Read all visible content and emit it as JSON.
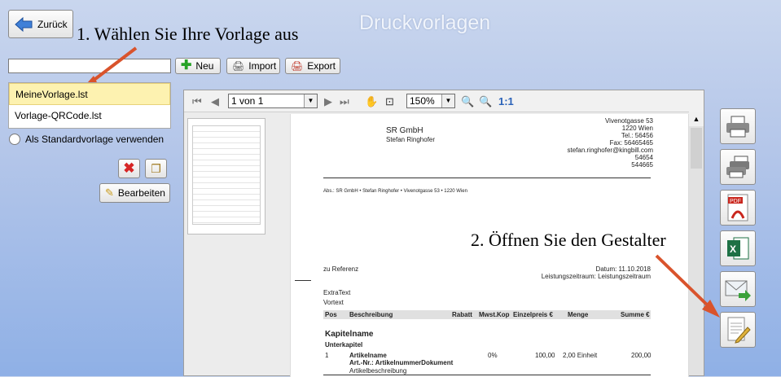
{
  "header": {
    "back_label": "Zurück",
    "title": "Druckvorlagen",
    "step1": "1. Wählen Sie Ihre Vorlage aus",
    "step2": "2. Öffnen Sie den Gestalter"
  },
  "toolbar": {
    "search_value": "",
    "new_label": "Neu",
    "import_label": "Import",
    "export_label": "Export"
  },
  "templates": [
    {
      "label": "MeineVorlage.lst",
      "selected": true
    },
    {
      "label": "Vorlage-QRCode.lst",
      "selected": false
    }
  ],
  "default_option": "Als Standardvorlage verwenden",
  "edit_label": "Bearbeiten",
  "viewer": {
    "page_combo": "1 von 1",
    "zoom_combo": "150%",
    "zoom_reset": "1:1"
  },
  "document": {
    "company": "SR GmbH",
    "contact": "Stefan Ringhofer",
    "address_lines": [
      "Vivenotgasse 53",
      "1220 Wien",
      "Tel.: 56456",
      "Fax: 56465465",
      "stefan.ringhofer@kingbill.com",
      "54654",
      "544665"
    ],
    "sender_line": "Abs.: SR GmbH • Stefan Ringhofer • Vivenotgasse 53 • 1220 Wien",
    "reference": "zu Referenz",
    "date": "Datum: 11.10.2018",
    "period": "Leistungszeitraum: Leistungszeitraum",
    "extra_text": "ExtraText",
    "vortext": "Vortext",
    "columns": [
      "Pos",
      "Beschreibung",
      "Rabatt",
      "Mwst.",
      "Kop",
      "Einzelpreis €",
      "Menge",
      "Summe €"
    ],
    "chapter": "Kapitelname",
    "subchapter": "Unterkapitel",
    "row": {
      "pos": "1",
      "name": "Artikelname",
      "artnr": "Art.-Nr.: ArtikelnummerDokument",
      "desc": "Artikelbeschreibung",
      "mwst": "0%",
      "price": "100,00",
      "qty": "2,00 Einheit",
      "sum": "200,00"
    }
  },
  "side_actions": [
    "print-icon",
    "print-multi-icon",
    "pdf-icon",
    "excel-icon",
    "email-icon",
    "edit-document-icon"
  ],
  "colors": {
    "accent_arrow": "#d9532c",
    "selection": "#fdf2b0"
  }
}
